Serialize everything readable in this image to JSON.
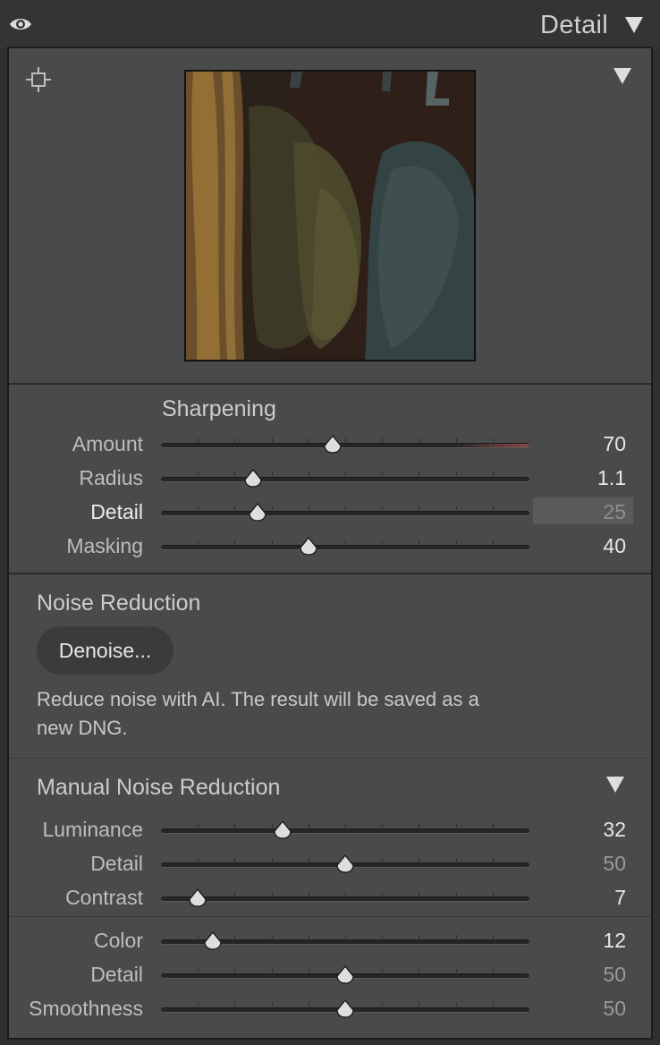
{
  "header": {
    "title": "Detail",
    "icons": {
      "visibility": "eye-icon",
      "collapse": "triangle-down-icon"
    }
  },
  "preview": {
    "icons": {
      "target": "crosshair-target-icon",
      "collapse": "triangle-down-icon"
    }
  },
  "sharpening": {
    "title": "Sharpening",
    "sliders": [
      {
        "label": "Amount",
        "value": "70",
        "fraction": 0.467,
        "active": false
      },
      {
        "label": "Radius",
        "value": "1.1",
        "fraction": 0.25,
        "active": false
      },
      {
        "label": "Detail",
        "value": "25",
        "fraction": 0.263,
        "active": true
      },
      {
        "label": "Masking",
        "value": "40",
        "fraction": 0.4,
        "active": false
      }
    ]
  },
  "noise_reduction": {
    "title": "Noise Reduction",
    "denoise_label": "Denoise...",
    "description": "Reduce noise with AI. The result will be saved as a new DNG."
  },
  "manual_noise_reduction": {
    "title": "Manual Noise Reduction",
    "luminance_sliders": [
      {
        "label": "Luminance",
        "value": "32",
        "fraction": 0.33,
        "dim": false
      },
      {
        "label": "Detail",
        "value": "50",
        "fraction": 0.5,
        "dim": true
      },
      {
        "label": "Contrast",
        "value": "7",
        "fraction": 0.1,
        "dim": false
      }
    ],
    "color_sliders": [
      {
        "label": "Color",
        "value": "12",
        "fraction": 0.14,
        "dim": false
      },
      {
        "label": "Detail",
        "value": "50",
        "fraction": 0.5,
        "dim": true
      },
      {
        "label": "Smoothness",
        "value": "50",
        "fraction": 0.5,
        "dim": true
      }
    ]
  },
  "colors": {
    "panel_bg": "#4a4a4a",
    "header_bg": "#343434",
    "amount_track_tint": "#8a4a4a"
  }
}
